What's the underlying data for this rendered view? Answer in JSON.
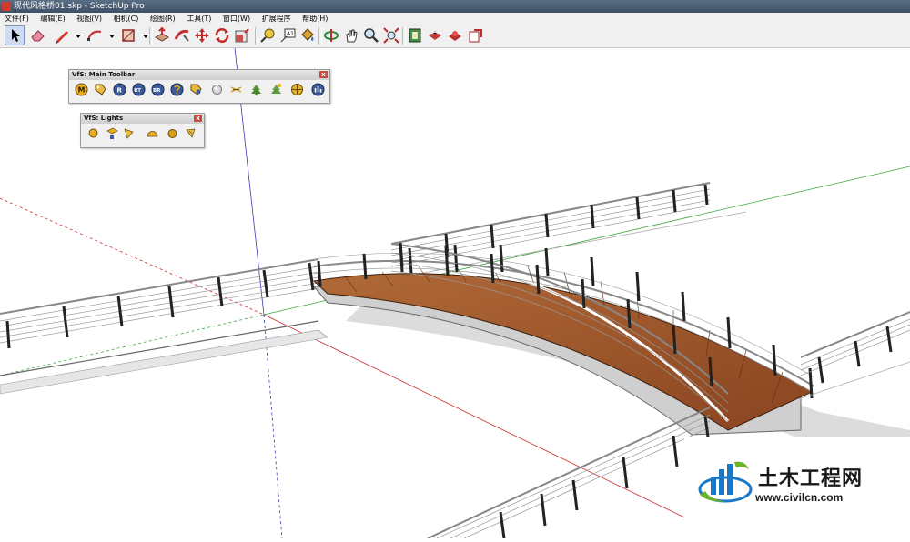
{
  "window": {
    "title": "现代风格桥01.skp - SketchUp Pro"
  },
  "menu": [
    "文件(F)",
    "编辑(E)",
    "视图(V)",
    "相机(C)",
    "绘图(R)",
    "工具(T)",
    "窗口(W)",
    "扩展程序",
    "帮助(H)"
  ],
  "vfs_main_toolbar": {
    "title": "VfS: Main Toolbar",
    "close_label": "x",
    "buttons": [
      "M",
      "",
      "R",
      "RT",
      "BR",
      "",
      "",
      "",
      "",
      "",
      "",
      "",
      ""
    ]
  },
  "vfs_lights": {
    "title": "VfS: Lights",
    "close_label": "x"
  },
  "watermark": {
    "brand": "土木工程网",
    "url": "www.civilcn.com"
  },
  "colors": {
    "title_bar": "#4a5c72",
    "axis_red": "#cc2a2a",
    "axis_green": "#3aa63a",
    "axis_blue": "#3a3ab0",
    "deck_wood": "#9a5228",
    "logo_blue": "#1a78c8",
    "logo_green": "#6ab42a"
  }
}
